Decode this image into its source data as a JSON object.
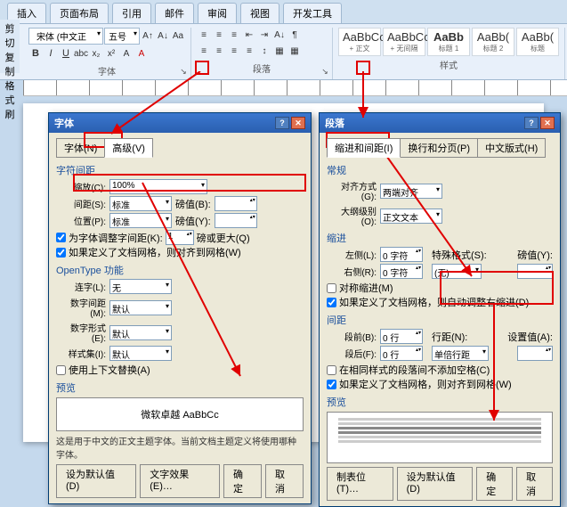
{
  "ribbon": {
    "tabs": [
      "插入",
      "页面布局",
      "引用",
      "邮件",
      "审阅",
      "视图",
      "开发工具"
    ],
    "left": {
      "cut": "剪切",
      "copy": "复制",
      "fmt": "格式刷"
    },
    "font": {
      "name": "宋体 (中文正",
      "size": "五号",
      "group": "字体"
    },
    "para": {
      "group": "段落"
    },
    "styles": {
      "group": "样式",
      "items": [
        {
          "a": "AaBbCcDd",
          "b": "+ 正文"
        },
        {
          "a": "AaBbCcDd",
          "b": "+ 无间隔"
        },
        {
          "a": "AaBb",
          "b": "标题 1"
        },
        {
          "a": "AaBb(",
          "b": "标题 2"
        },
        {
          "a": "AaBb(",
          "b": "标题"
        }
      ]
    }
  },
  "fontDlg": {
    "title": "字体",
    "tabFont": "字体(N)",
    "tabAdv": "高级(V)",
    "secSpacing": "字符间距",
    "scale": "缩放(C):",
    "scaleVal": "100%",
    "spacing": "间距(S):",
    "spacingVal": "标准",
    "pt": "磅值(B):",
    "pos": "位置(P):",
    "posVal": "标准",
    "pt2": "磅值(Y):",
    "kern": "为字体调整字间距(K):",
    "kernUnit": "磅或更大(Q)",
    "snap": "如果定义了文档网格，则对齐到网格(W)",
    "secOT": "OpenType 功能",
    "lig": "连字(L):",
    "ligVal": "无",
    "numSp": "数字间距(M):",
    "numSpVal": "默认",
    "numFm": "数字形式(E):",
    "numFmVal": "默认",
    "styl": "样式集(I):",
    "stylVal": "默认",
    "ctx": "使用上下文替换(A)",
    "secPrev": "预览",
    "prevText": "微软卓越 AaBbCc",
    "hint": "这是用于中文的正文主题字体。当前文档主题定义将使用哪种字体。",
    "btnDefault": "设为默认值(D)",
    "btnEffect": "文字效果(E)…",
    "btnOK": "确定",
    "btnCancel": "取消"
  },
  "paraDlg": {
    "title": "段落",
    "tab1": "缩进和间距(I)",
    "tab2": "换行和分页(P)",
    "tab3": "中文版式(H)",
    "secGen": "常规",
    "align": "对齐方式(G):",
    "alignVal": "两端对齐",
    "outline": "大纲级别(O):",
    "outlineVal": "正文文本",
    "secIndent": "缩进",
    "left": "左侧(L):",
    "leftVal": "0 字符",
    "special": "特殊格式(S):",
    "by": "磅值(Y):",
    "right": "右侧(R):",
    "rightVal": "0 字符",
    "specialVal": "(无)",
    "mirror": "对称缩进(M)",
    "autoAdj": "如果定义了文档网格，则自动调整右缩进(D)",
    "secSpace": "间距",
    "before": "段前(B):",
    "beforeVal": "0 行",
    "line": "行距(N):",
    "at": "设置值(A):",
    "after": "段后(F):",
    "afterVal": "0 行",
    "lineVal": "单倍行距",
    "noAdd": "在相同样式的段落间不添加空格(C)",
    "snap": "如果定义了文档网格，则对齐到网格(W)",
    "secPrev": "预览",
    "btnTab": "制表位(T)…",
    "btnDefault": "设为默认值(D)",
    "btnOK": "确定",
    "btnCancel": "取消"
  }
}
